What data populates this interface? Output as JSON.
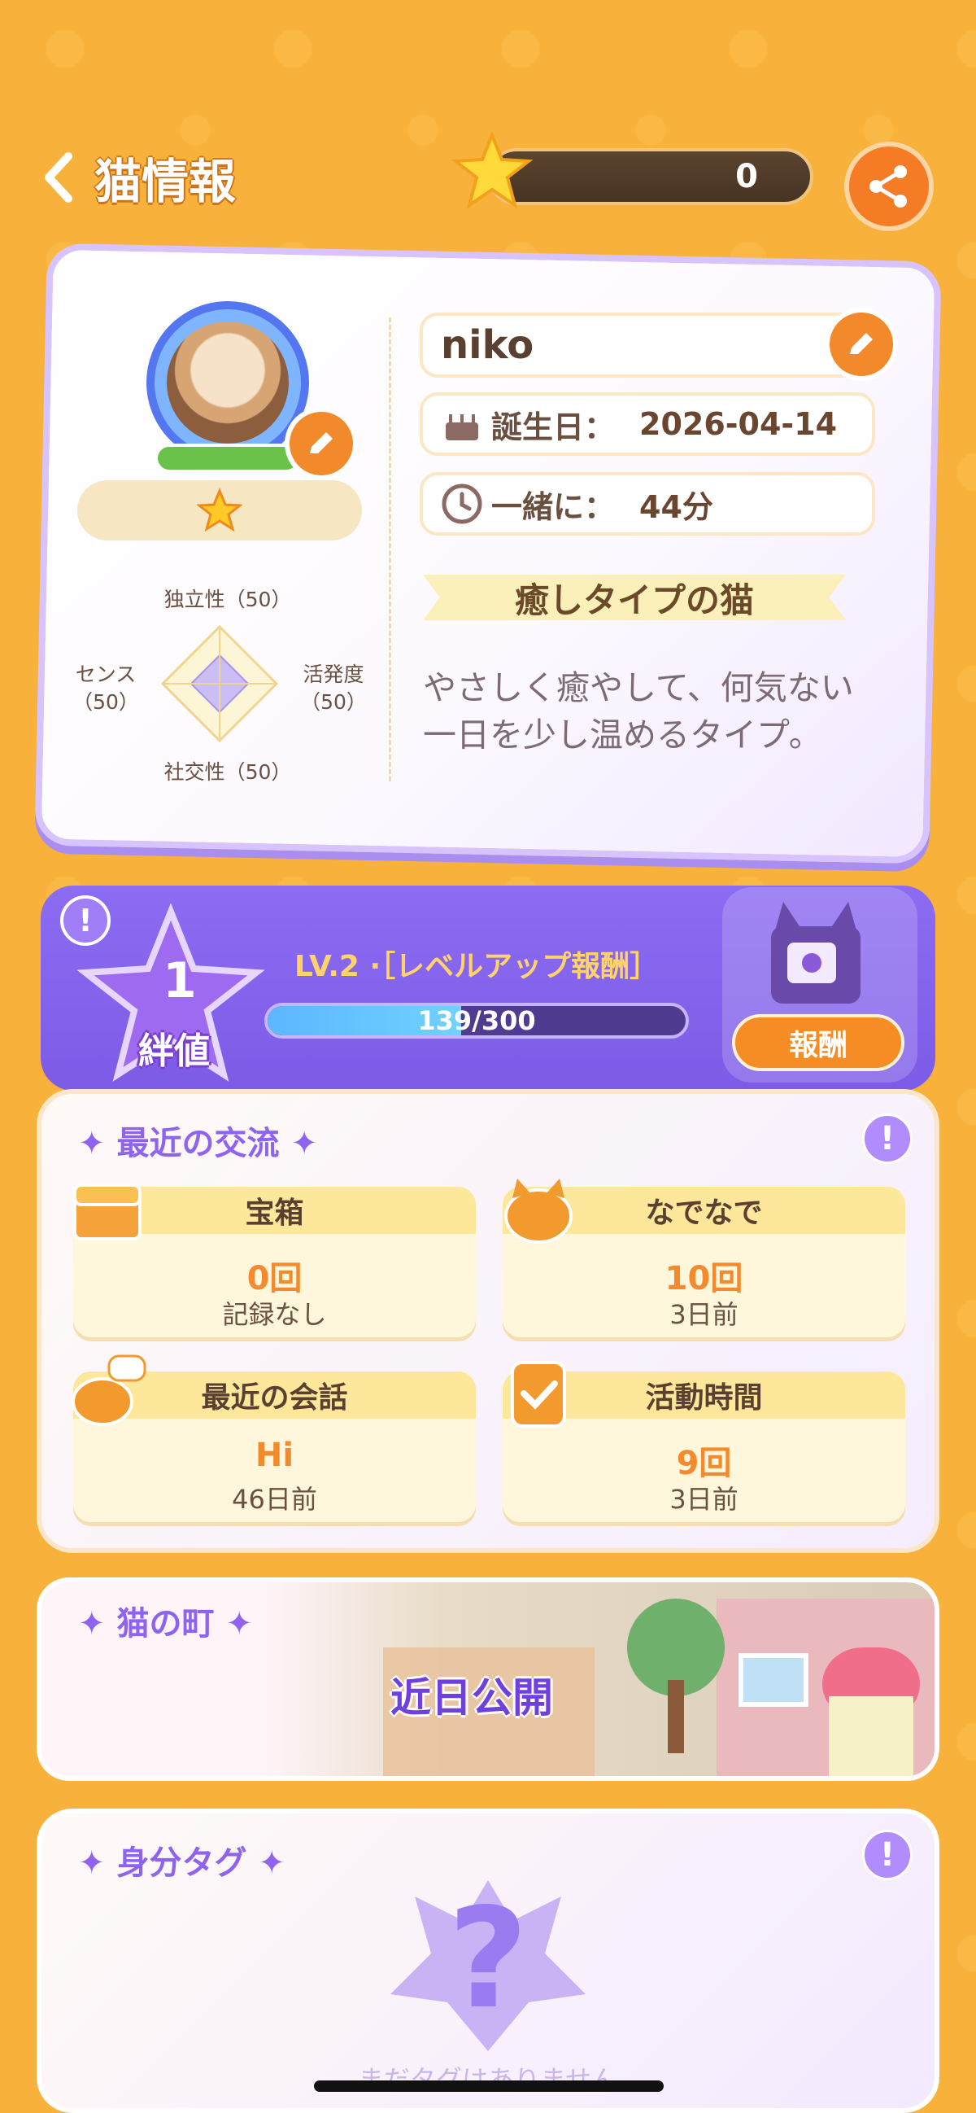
{
  "header": {
    "title": "猫情報",
    "star_count": "0"
  },
  "profile": {
    "name": "niko",
    "birthday_label": "誕生日：",
    "birthday_value": "2026-04-14",
    "together_label": "一緒に：",
    "together_value": "44分",
    "rating_stars": 1,
    "personality": {
      "top": "独立性（50）",
      "left_line1": "センス",
      "left_line2": "（50）",
      "right_line1": "活発度",
      "right_line2": "（50）",
      "bottom": "社交性（50）",
      "values": {
        "independence": 50,
        "sense": 50,
        "activity": 50,
        "sociability": 50
      }
    },
    "type_title": "癒しタイプの猫",
    "type_description": "やさしく癒やして、何気ない一日を少し温めるタイプ。"
  },
  "level": {
    "bond_number": "1",
    "bond_label": "絆値",
    "title": "LV.2 ·［レベルアップ報酬］",
    "progress_text": "139/300",
    "progress_value": 139,
    "progress_max": 300,
    "reward_button": "報酬",
    "info_mark": "!"
  },
  "interactions": {
    "title": "最近の交流",
    "info_mark": "!",
    "tiles": [
      {
        "label": "宝箱",
        "value": "0回",
        "sub": "記録なし",
        "icon": "treasure-chest-icon"
      },
      {
        "label": "なでなで",
        "value": "10回",
        "sub": "3日前",
        "icon": "pet-cat-icon"
      },
      {
        "label": "最近の会話",
        "value": "Hi",
        "sub": "46日前",
        "icon": "chat-cat-icon"
      },
      {
        "label": "活動時間",
        "value": "9回",
        "sub": "3日前",
        "icon": "clipboard-check-icon"
      }
    ]
  },
  "town": {
    "title": "猫の町",
    "status": "近日公開"
  },
  "tags": {
    "title": "身分タグ",
    "info_mark": "!",
    "empty_text": "まだタグはありません"
  },
  "colors": {
    "background": "#f8b23c",
    "accent_orange": "#f28a2c",
    "accent_purple": "#8e63f0"
  }
}
